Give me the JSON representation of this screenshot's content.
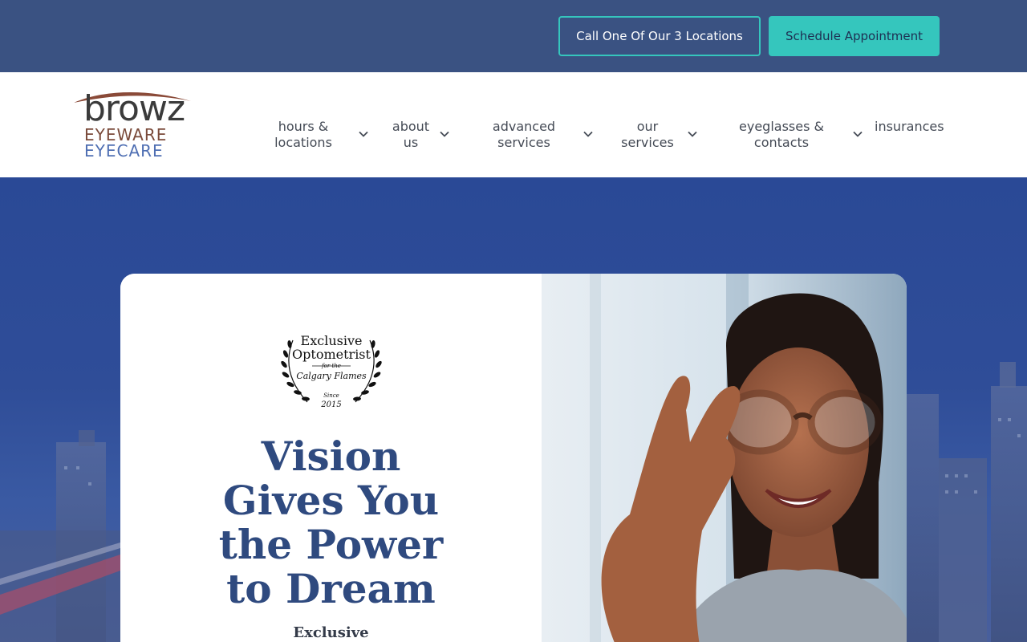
{
  "topbar": {
    "call_label": "Call One Of Our 3 Locations",
    "schedule_label": "Schedule Appointment"
  },
  "logo": {
    "line1": "browz",
    "line2": "EYEWARE",
    "line3": "EYECARE"
  },
  "nav": {
    "items": [
      {
        "line1": "hours &",
        "line2": "locations",
        "has_dropdown": true
      },
      {
        "line1": "about",
        "line2": "us",
        "has_dropdown": true
      },
      {
        "line1": "advanced",
        "line2": "services",
        "has_dropdown": true
      },
      {
        "line1": "our",
        "line2": "services",
        "has_dropdown": true
      },
      {
        "line1": "eyeglasses &",
        "line2": "contacts",
        "has_dropdown": true
      },
      {
        "line1": "insurances",
        "line2": "",
        "has_dropdown": false
      }
    ]
  },
  "hero": {
    "award": {
      "line1": "Exclusive",
      "line2": "Optometrist",
      "line3": "for the",
      "line4": "Calgary Flames",
      "line5": "Since",
      "line6": "2015"
    },
    "headline": [
      "Vision",
      "Gives You",
      "the Power",
      "to Dream"
    ],
    "subheadline": "Exclusive"
  },
  "colors": {
    "topbar_bg": "#3a5282",
    "accent_teal": "#35c6bd",
    "headline": "#2f4a7f",
    "nav_text": "#444a55"
  },
  "icons": [
    "chevron-down-icon",
    "laurel-wreath-icon"
  ]
}
